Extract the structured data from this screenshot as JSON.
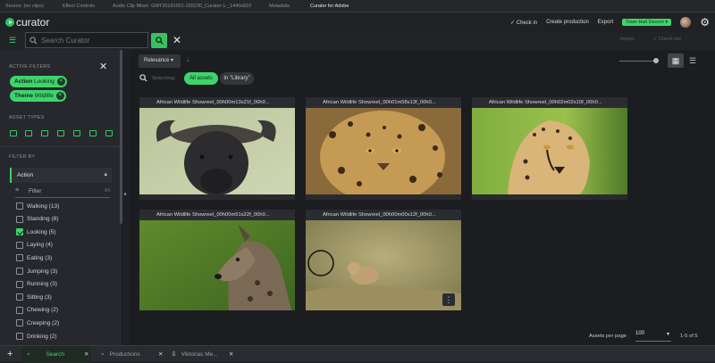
{
  "panel_tabs": [
    "Source: (no clips)",
    "Effect Controls",
    "Audio Clip Mixer: GMT20191001-155230_Curator-1-_1440x810",
    "Metadata",
    "Curator for Adobe"
  ],
  "app": {
    "logo_text": "curator"
  },
  "header": {
    "checkin": "Check in",
    "create_production": "Create production",
    "export": "Export",
    "user_button": "Town Hall Decem"
  },
  "search": {
    "placeholder": "Search Curator"
  },
  "toolbar2": {
    "import": "Import",
    "checkout": "Check out"
  },
  "filters": {
    "active_label": "ACTIVE FILTERS",
    "chips": [
      {
        "key": "Action",
        "value": "Looking"
      },
      {
        "key": "Theme",
        "value": "Wildlife"
      }
    ],
    "asset_types_label": "ASSET TYPES",
    "filter_by_label": "FILTER BY",
    "facet_name": "Action",
    "filter_placeholder": "Filter",
    "filter_all": "All",
    "facets": [
      {
        "label": "Walking (13)",
        "checked": false
      },
      {
        "label": "Standing (8)",
        "checked": false
      },
      {
        "label": "Looking (5)",
        "checked": true
      },
      {
        "label": "Laying (4)",
        "checked": false
      },
      {
        "label": "Eating (3)",
        "checked": false
      },
      {
        "label": "Jumping (3)",
        "checked": false
      },
      {
        "label": "Running (3)",
        "checked": false
      },
      {
        "label": "Sitting (3)",
        "checked": false
      },
      {
        "label": "Chewing (2)",
        "checked": false
      },
      {
        "label": "Creeping (2)",
        "checked": false
      },
      {
        "label": "Drinking (2)",
        "checked": false
      }
    ]
  },
  "main": {
    "sort_label": "Relevance",
    "searching_label": "Searching:",
    "scope_all": "All assets",
    "scope_library": "In \"Library\"",
    "assets": [
      {
        "title": "African Wildlife Showreel_00h00m13s21f_00h0..."
      },
      {
        "title": "African Wildlife Showreel_00h01m58s13f_00h0..."
      },
      {
        "title": "African Wildlife Showreel_00h02m02s10f_00h0..."
      },
      {
        "title": "African Wildlife Showreel_00h00m51s22f_00h0..."
      },
      {
        "title": "African Wildlife Showreel_00h00m00s12f_00h0..."
      }
    ],
    "assets_per_page_label": "Assets per page",
    "assets_per_page_value": "100",
    "range": "1-5 of 5"
  },
  "bottom_tabs": {
    "search": "Search",
    "productions": "Productions",
    "user": "Viktorias Me..."
  },
  "colors": {
    "accent": "#3fd36c",
    "background": "#1c1d21",
    "sidebar": "#27282d"
  }
}
